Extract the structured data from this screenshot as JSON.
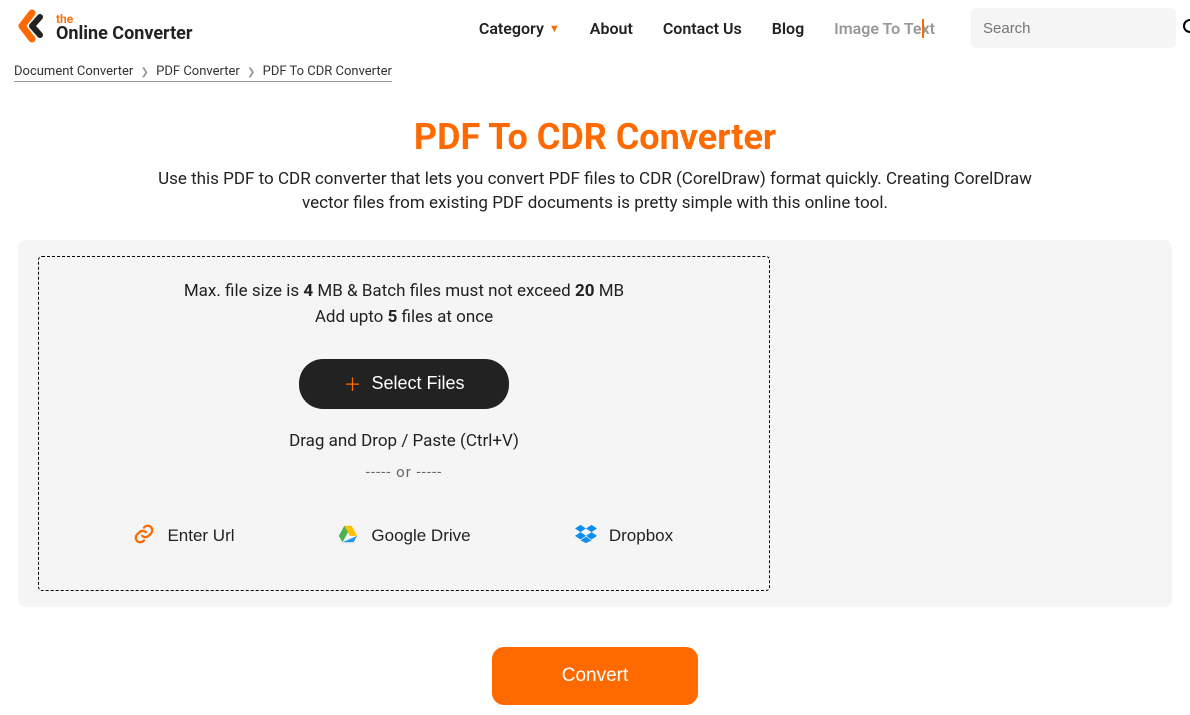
{
  "header": {
    "logo_the": "the",
    "logo_main": "Online Converter",
    "nav": {
      "category": "Category",
      "about": "About",
      "contact": "Contact Us",
      "blog": "Blog",
      "imgtotext": "Image To Text"
    },
    "search_placeholder": "Search"
  },
  "breadcrumb": {
    "a": "Document Converter",
    "b": "PDF Converter",
    "c": "PDF To CDR Converter"
  },
  "main": {
    "title": "PDF To CDR Converter",
    "desc": "Use this PDF to CDR converter that lets you convert PDF files to CDR (CorelDraw) format quickly. Creating CorelDraw vector files from existing PDF documents is pretty simple with this online tool.",
    "limits_pre": "Max. file size is ",
    "limits_b1": "4",
    "limits_mid": " MB & Batch files must not exceed ",
    "limits_b2": "20",
    "limits_suf": " MB",
    "limits2_pre": "Add upto ",
    "limits2_b": "5",
    "limits2_suf": " files at once",
    "select": "Select Files",
    "dragdrop": "Drag and Drop / Paste (Ctrl+V)",
    "or": "-----  or  -----",
    "url_btn": "Enter Url",
    "gdrive_btn": "Google Drive",
    "dropbox_btn": "Dropbox",
    "convert": "Convert"
  }
}
